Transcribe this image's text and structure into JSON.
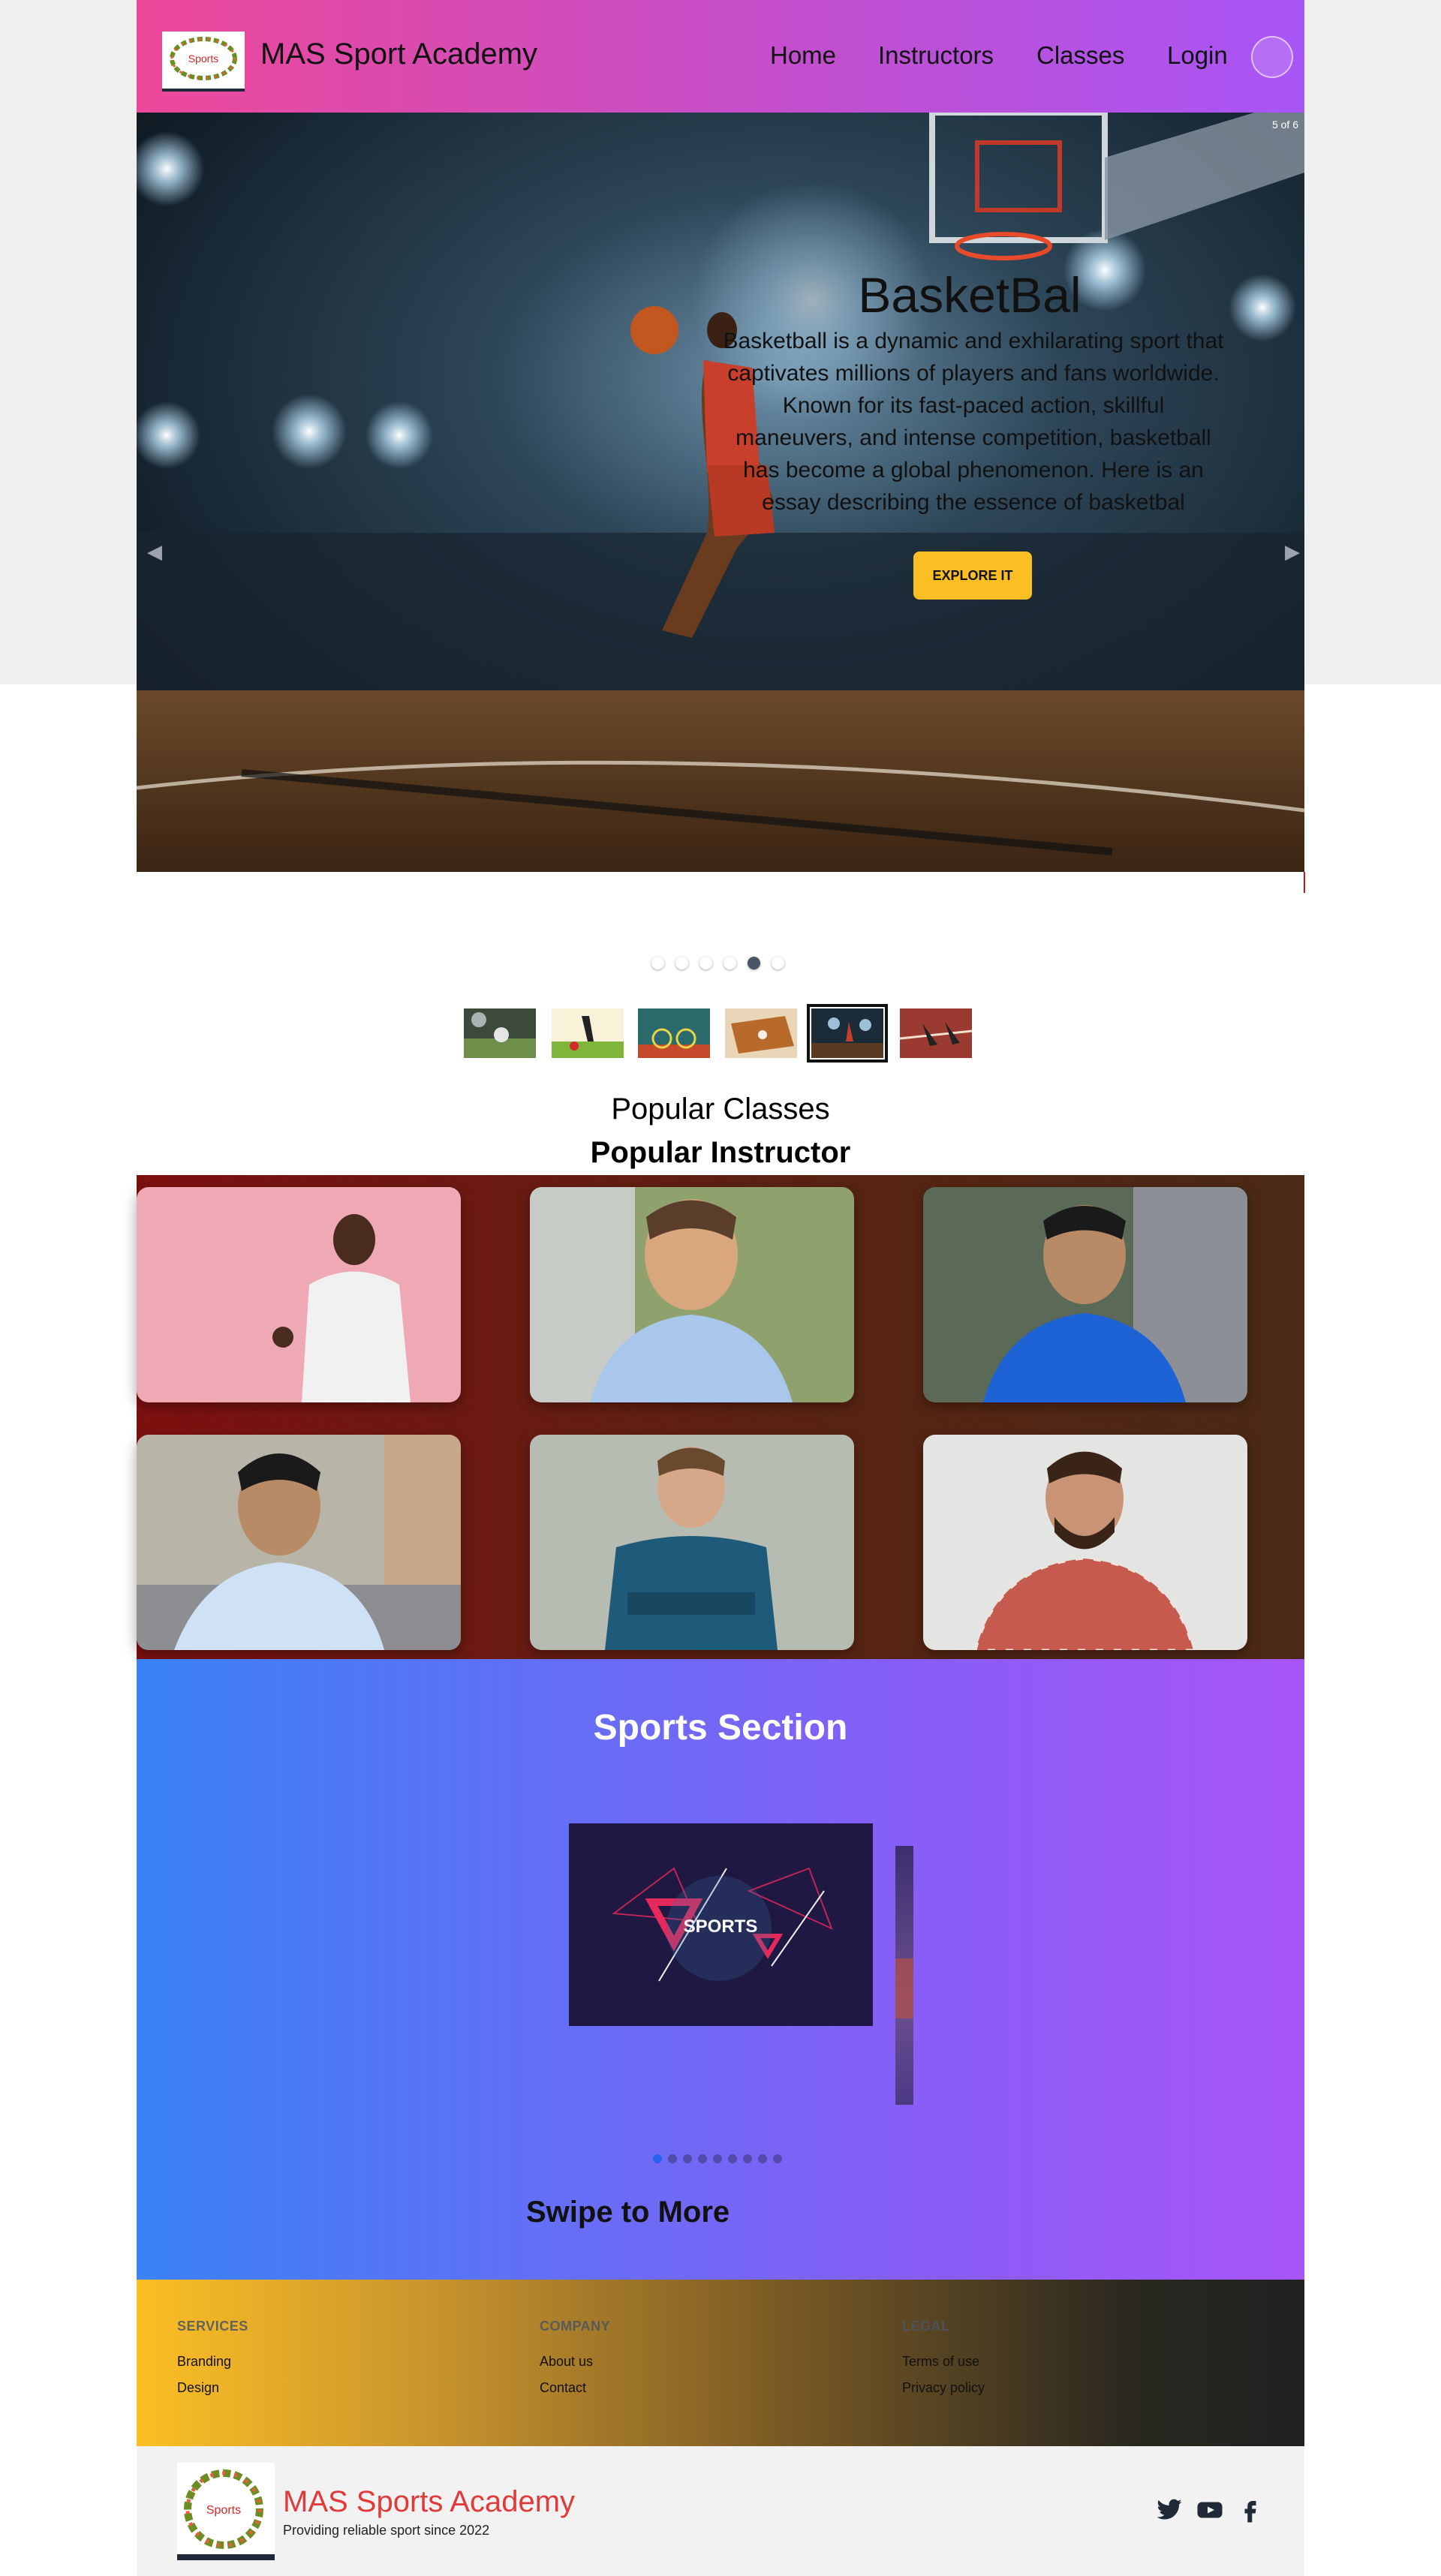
{
  "brand": {
    "name": "MAS Sport Academy",
    "logo_text": "Sports"
  },
  "nav": {
    "links": [
      "Home",
      "Instructors",
      "Classes",
      "Login"
    ]
  },
  "hero": {
    "counter": "5 of 6",
    "title": "BasketBal",
    "description": "Basketball is a dynamic and exhilarating sport that captivates millions of players and fans worldwide. Known for its fast-paced action, skillful maneuvers, and intense competition, basketball has become a global phenomenon. Here is an essay describing the essence of basketbal",
    "button": "EXPLORE IT",
    "prev_icon": "chevron-left-icon",
    "next_icon": "chevron-right-icon",
    "slide_count": 6,
    "active_slide": 5
  },
  "popular_classes": {
    "title": "Popular Classes"
  },
  "popular_instructor": {
    "title": "Popular Instructor"
  },
  "sports_section": {
    "title": "Sports Section",
    "card_text": "SPORTS",
    "dot_count": 9,
    "active_dot": 1,
    "swipe_text": "Swipe to More"
  },
  "footer": {
    "services": {
      "heading": "SERVICES",
      "links": [
        "Branding",
        "Design"
      ]
    },
    "company": {
      "heading": "COMPANY",
      "links": [
        "About us",
        "Contact"
      ]
    },
    "legal": {
      "heading": "LEGAL",
      "links": [
        "Terms of use",
        "Privacy policy"
      ]
    },
    "brand_name": "MAS Sports Academy",
    "tagline": "Providing reliable sport since 2022",
    "logo_text": "Sports",
    "social_icons": [
      "twitter-icon",
      "youtube-icon",
      "facebook-icon"
    ]
  },
  "colors": {
    "nav_gradient": [
      "#ec4899",
      "#a855f7"
    ],
    "button": "#fbbf24",
    "brand_red": "#e03b3b",
    "sports_gradient": [
      "#3b82f6",
      "#a855f7"
    ]
  }
}
